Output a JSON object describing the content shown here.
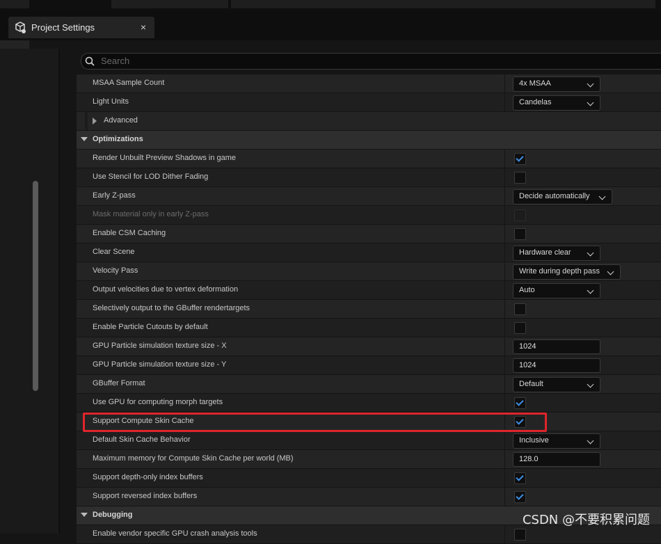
{
  "window": {
    "tab_title": "Project Settings",
    "tab_close": "×"
  },
  "search": {
    "placeholder": "Search"
  },
  "rows": [
    {
      "type": "setting",
      "label": "MSAA Sample Count",
      "control": "dropdown",
      "value": "4x MSAA"
    },
    {
      "type": "setting",
      "label": "Light Units",
      "control": "dropdown",
      "value": "Candelas"
    },
    {
      "type": "subsection",
      "label": "Advanced"
    },
    {
      "type": "section",
      "label": "Optimizations"
    },
    {
      "type": "setting",
      "label": "Render Unbuilt Preview Shadows in game",
      "control": "checkbox",
      "checked": true
    },
    {
      "type": "setting",
      "label": "Use Stencil for LOD Dither Fading",
      "control": "checkbox",
      "checked": false
    },
    {
      "type": "setting",
      "label": "Early Z-pass",
      "control": "dropdown",
      "value": "Decide automatically"
    },
    {
      "type": "setting",
      "label": "Mask material only in early Z-pass",
      "control": "checkbox",
      "checked": false,
      "disabled": true
    },
    {
      "type": "setting",
      "label": "Enable CSM Caching",
      "control": "checkbox",
      "checked": false
    },
    {
      "type": "setting",
      "label": "Clear Scene",
      "control": "dropdown",
      "value": "Hardware clear"
    },
    {
      "type": "setting",
      "label": "Velocity Pass",
      "control": "dropdown",
      "value": "Write during depth pass"
    },
    {
      "type": "setting",
      "label": "Output velocities due to vertex deformation",
      "control": "dropdown",
      "value": "Auto"
    },
    {
      "type": "setting",
      "label": "Selectively output to the GBuffer rendertargets",
      "control": "checkbox",
      "checked": false
    },
    {
      "type": "setting",
      "label": "Enable Particle Cutouts by default",
      "control": "checkbox",
      "checked": false
    },
    {
      "type": "setting",
      "label": "GPU Particle simulation texture size - X",
      "control": "number",
      "value": "1024"
    },
    {
      "type": "setting",
      "label": "GPU Particle simulation texture size - Y",
      "control": "number",
      "value": "1024"
    },
    {
      "type": "setting",
      "label": "GBuffer Format",
      "control": "dropdown",
      "value": "Default"
    },
    {
      "type": "setting",
      "label": "Use GPU for computing morph targets",
      "control": "checkbox",
      "checked": true
    },
    {
      "type": "setting",
      "label": "Support Compute Skin Cache",
      "control": "checkbox",
      "checked": true
    },
    {
      "type": "setting",
      "label": "Default Skin Cache Behavior",
      "control": "dropdown",
      "value": "Inclusive"
    },
    {
      "type": "setting",
      "label": "Maximum memory for Compute Skin Cache per world (MB)",
      "control": "number",
      "value": "128.0"
    },
    {
      "type": "setting",
      "label": "Support depth-only index buffers",
      "control": "checkbox",
      "checked": true
    },
    {
      "type": "setting",
      "label": "Support reversed index buffers",
      "control": "checkbox",
      "checked": true
    },
    {
      "type": "section",
      "label": "Debugging"
    },
    {
      "type": "setting",
      "label": "Enable vendor specific GPU crash analysis tools",
      "control": "checkbox",
      "checked": false
    }
  ],
  "watermark": "CSDN @不要积累问题",
  "colors": {
    "accent_check": "#3d8ee6",
    "highlight_box": "#e0252c"
  }
}
